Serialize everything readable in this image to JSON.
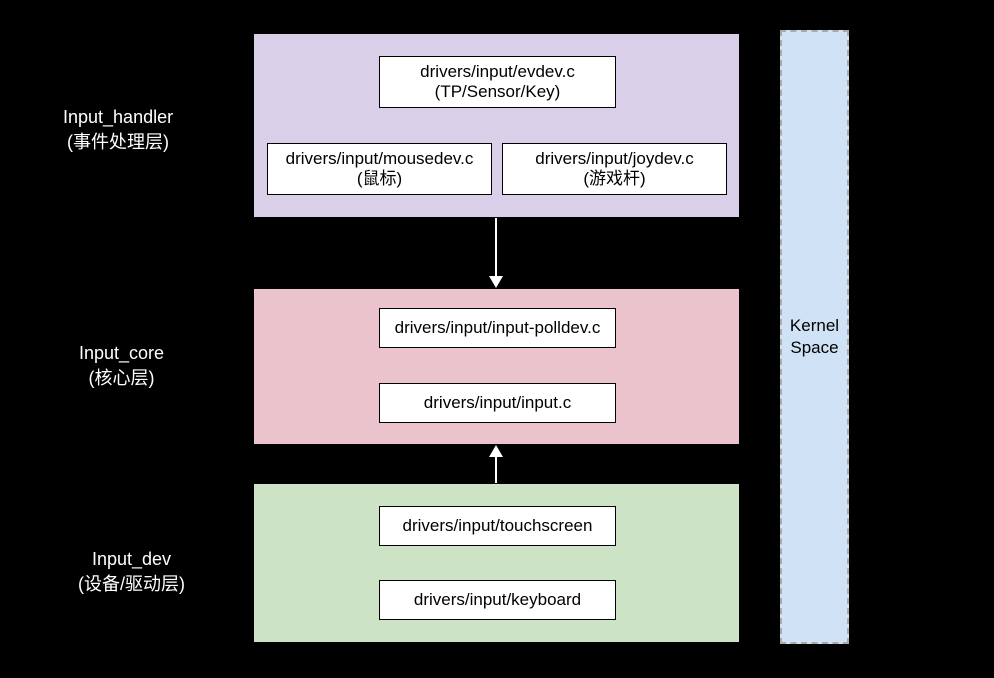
{
  "leftLabels": {
    "handler": {
      "line1": "Input_handler",
      "line2": "(事件处理层)"
    },
    "core": {
      "line1": "Input_core",
      "line2": "(核心层)"
    },
    "dev": {
      "line1": "Input_dev",
      "line2": "(设备/驱动层)"
    }
  },
  "sections": {
    "handler": {
      "bg": "#d9cfe8",
      "items": {
        "evdev": {
          "line1": "drivers/input/evdev.c",
          "line2": "(TP/Sensor/Key)"
        },
        "mousedev": {
          "line1": "drivers/input/mousedev.c",
          "line2": "(鼠标)"
        },
        "joydev": {
          "line1": "drivers/input/joydev.c",
          "line2": "(游戏杆)"
        }
      }
    },
    "core": {
      "bg": "#eac3cc",
      "items": {
        "polldev": {
          "line1": "drivers/input/input-polldev.c"
        },
        "input": {
          "line1": "drivers/input/input.c"
        }
      }
    },
    "dev": {
      "bg": "#cde3c5",
      "items": {
        "touch": {
          "line1": "drivers/input/touchscreen"
        },
        "keyboard": {
          "line1": "drivers/input/keyboard"
        }
      }
    }
  },
  "kernel": {
    "line1": "Kernel",
    "line2": "Space"
  }
}
